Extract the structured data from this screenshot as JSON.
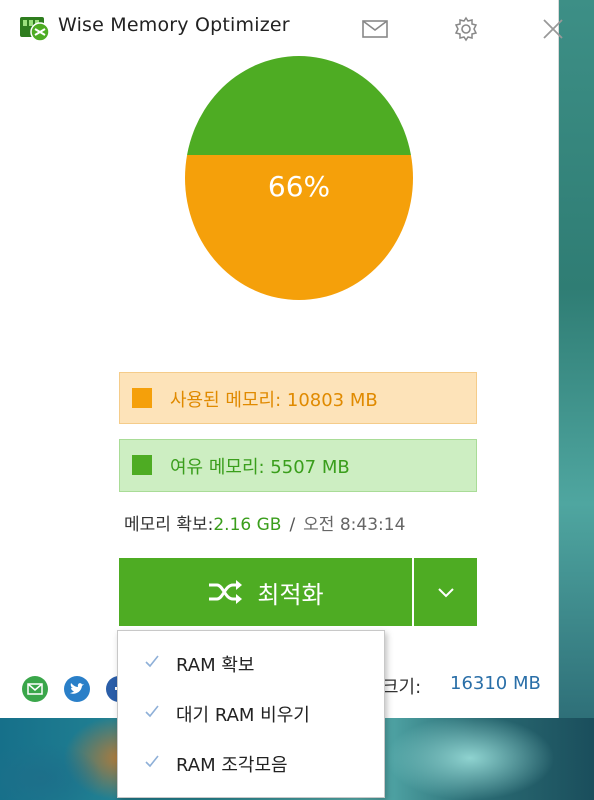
{
  "window": {
    "title": "Wise Memory Optimizer",
    "icons": {
      "mail": "mail-icon",
      "settings": "gear-icon",
      "close": "close-icon"
    }
  },
  "gauge": {
    "percent_label": "66%",
    "used_fraction": 0.66,
    "used_color": "#f5a00a",
    "free_color": "#4eac23"
  },
  "memory": {
    "used_label": "사용된 메모리: 10803 MB",
    "free_label": "여유 메모리: 5507 MB",
    "freed_label": "메모리 확보:",
    "freed_value": "2.16 GB",
    "separator": "/",
    "time_label": "오전 8:43:14",
    "total_label": "크기:",
    "total_value": "16310 MB"
  },
  "actions": {
    "optimize_label": "최적화"
  },
  "menu": {
    "items": [
      {
        "label": "RAM 확보",
        "checked": true
      },
      {
        "label": "대기 RAM 비우기",
        "checked": true
      },
      {
        "label": "RAM 조각모음",
        "checked": true
      }
    ]
  },
  "social": [
    "email-share-icon",
    "twitter-icon",
    "facebook-icon"
  ],
  "colors": {
    "accent": "#4eac23",
    "used": "#f5a00a",
    "link": "#2a6fa8"
  }
}
